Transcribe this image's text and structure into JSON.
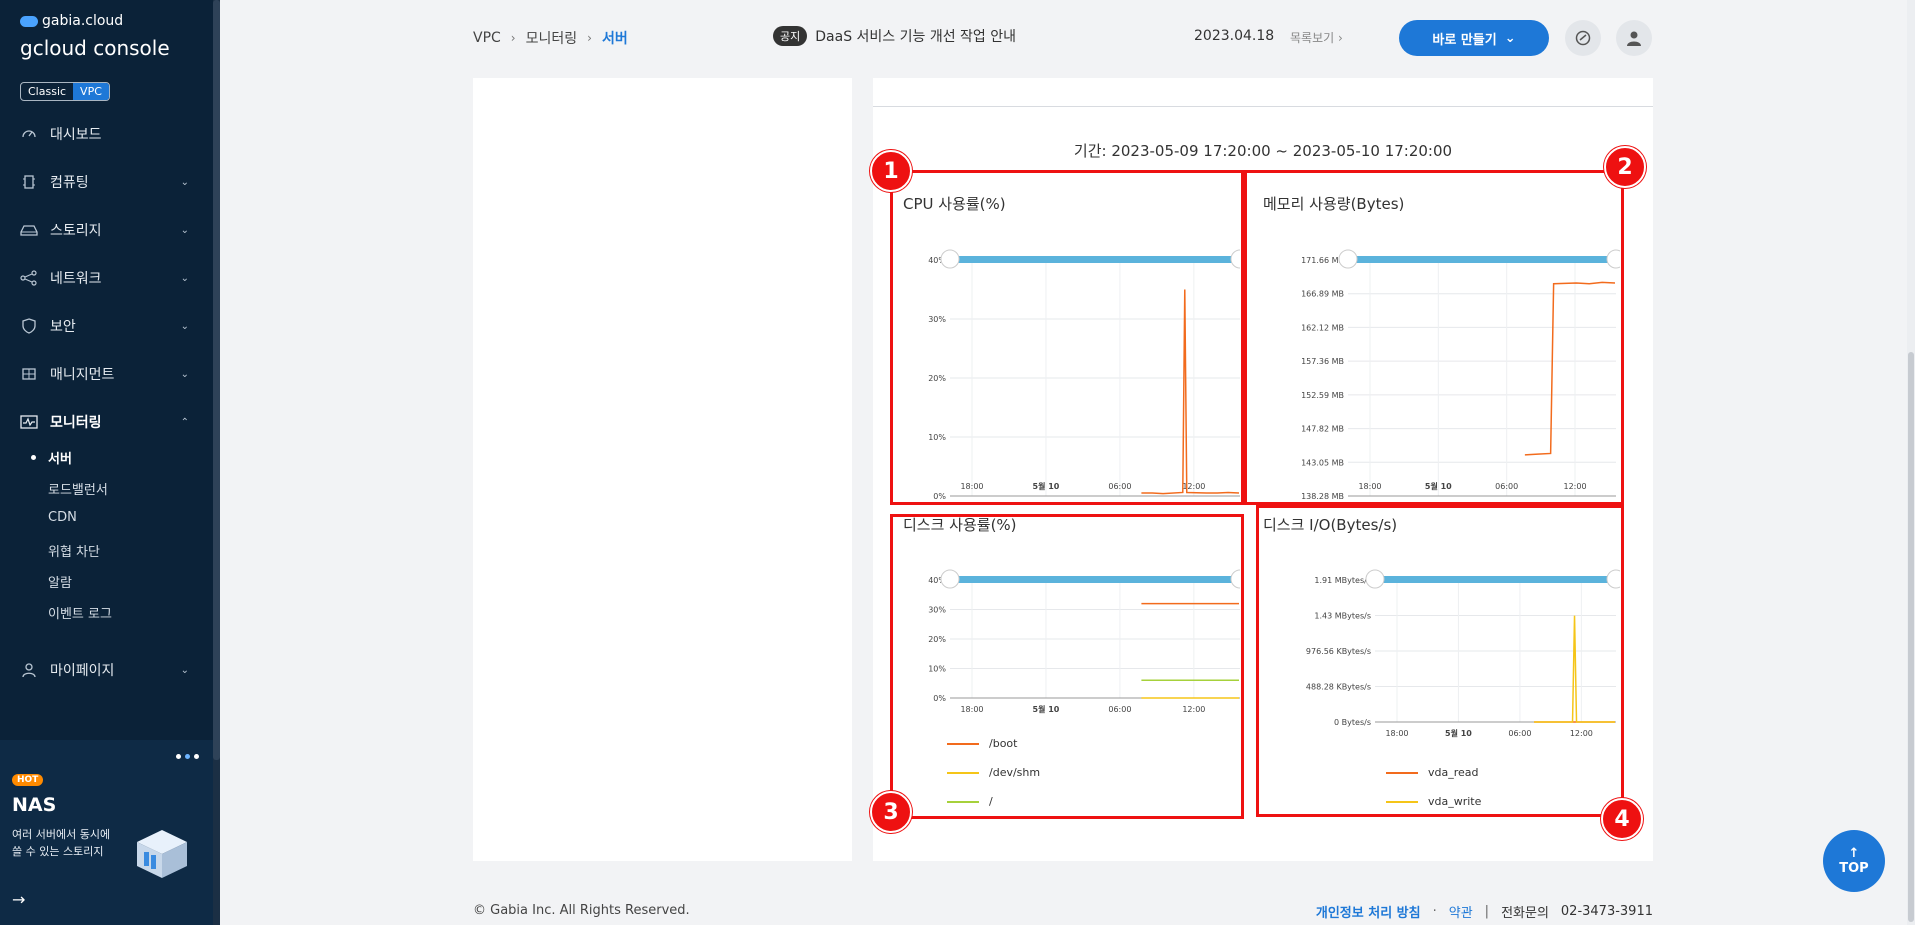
{
  "sidebar": {
    "brand_top": "gabia.cloud",
    "brand_console": "gcloud console",
    "env_classic": "Classic",
    "env_vpc": "VPC",
    "items": [
      {
        "label": "대시보드",
        "icon": "gauge-icon"
      },
      {
        "label": "컴퓨팅",
        "icon": "chip-icon"
      },
      {
        "label": "스토리지",
        "icon": "storage-icon"
      },
      {
        "label": "네트워크",
        "icon": "network-icon"
      },
      {
        "label": "보안",
        "icon": "shield-icon"
      },
      {
        "label": "매니지먼트",
        "icon": "management-icon"
      },
      {
        "label": "모니터링",
        "icon": "monitor-icon"
      },
      {
        "label": "마이페이지",
        "icon": "user-icon"
      }
    ],
    "monitoring_sub": [
      "서버",
      "로드밸런서",
      "CDN",
      "위협 차단",
      "알람",
      "이벤트 로그"
    ],
    "promo": {
      "badge": "HOT",
      "title": "NAS",
      "desc_line1": "여러 서버에서 동시에",
      "desc_line2": "쓸 수 있는 스토리지"
    }
  },
  "header": {
    "breadcrumb": [
      "VPC",
      "모니터링",
      "서버"
    ],
    "notice_badge": "공지",
    "notice_text": "DaaS 서비스 기능 개선 작업 안내",
    "notice_date": "2023.04.18",
    "notice_list": "목록보기",
    "create_label": "바로 만들기"
  },
  "main": {
    "period": "기간: 2023-05-09 17:20:00 ~ 2023-05-10 17:20:00",
    "markers": [
      "1",
      "2",
      "3",
      "4"
    ]
  },
  "chart_data": [
    {
      "type": "line",
      "title": "CPU 사용률(%)",
      "y_ticks": [
        "40%",
        "30%",
        "20%",
        "10%",
        "0%"
      ],
      "x_ticks": [
        "18:00",
        "5월 10",
        "06:00",
        "12:00"
      ],
      "ylim": [
        0,
        40
      ],
      "series": [
        {
          "color": "#f26b1d",
          "values": [
            0.5,
            0.5,
            0.4,
            0.6,
            35,
            0.6,
            0.5,
            0.5,
            0.6,
            0.5
          ]
        }
      ]
    },
    {
      "type": "line",
      "title": "메모리 사용량(Bytes)",
      "y_ticks": [
        "171.66 MB",
        "166.89 MB",
        "162.12 MB",
        "157.36 MB",
        "152.59 MB",
        "147.82 MB",
        "143.05 MB",
        "138.28 MB"
      ],
      "x_ticks": [
        "18:00",
        "5월 10",
        "06:00",
        "12:00"
      ],
      "ylim": [
        138.28,
        171.66
      ],
      "series": [
        {
          "color": "#f26b1d",
          "values": [
            144.1,
            144.2,
            144.3,
            168.3,
            168.4,
            168.3,
            168.5,
            168.4
          ]
        }
      ]
    },
    {
      "type": "line",
      "title": "디스크 사용률(%)",
      "y_ticks": [
        "40%",
        "30%",
        "20%",
        "10%",
        "0%"
      ],
      "x_ticks": [
        "18:00",
        "5월 10",
        "06:00",
        "12:00"
      ],
      "ylim": [
        0,
        40
      ],
      "series": [
        {
          "name": "/boot",
          "color": "#f26b1d",
          "values": [
            32,
            32
          ]
        },
        {
          "name": "/dev/shm",
          "color": "#f5c518",
          "values": [
            0,
            0
          ]
        },
        {
          "name": "/",
          "color": "#a6d13b",
          "values": [
            6,
            6
          ]
        }
      ]
    },
    {
      "type": "line",
      "title": "디스크 I/O(Bytes/s)",
      "y_ticks": [
        "1.91 MBytes/s",
        "1.43 MBytes/s",
        "976.56 KBytes/s",
        "488.28 KBytes/s",
        "0 Bytes/s"
      ],
      "x_ticks": [
        "18:00",
        "5월 10",
        "06:00",
        "12:00"
      ],
      "ylim": [
        0,
        1.91
      ],
      "series": [
        {
          "name": "vda_read",
          "color": "#f26b1d",
          "values": [
            0,
            0,
            0,
            0,
            0
          ]
        },
        {
          "name": "vda_write",
          "color": "#f5c518",
          "values": [
            0,
            0,
            1.43,
            0,
            0
          ]
        }
      ]
    }
  ],
  "footer": {
    "copyright": "© Gabia Inc. All Rights Reserved.",
    "privacy": "개인정보 처리 방침",
    "dot": "·",
    "terms": "약관",
    "sep": "|",
    "contact_label": "전화문의",
    "contact_number": "02-3473-3911",
    "top_label": "TOP"
  },
  "colors": {
    "accent": "#1e78d7",
    "sidebar_bg": "#0b2238",
    "highlight": "#ee1111",
    "series_orange": "#f26b1d",
    "series_yellow": "#f5c518",
    "series_green": "#a6d13b",
    "range_bar": "#5bb3dc"
  }
}
